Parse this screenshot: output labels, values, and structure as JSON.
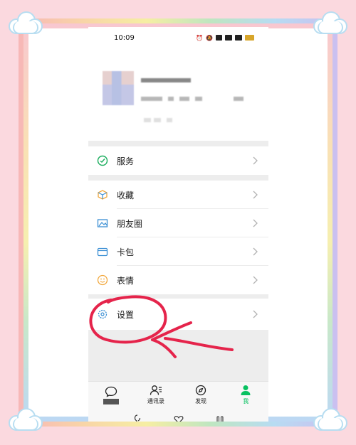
{
  "statusbar": {
    "time": "10:09"
  },
  "menu": {
    "services": "服务",
    "favorites": "收藏",
    "moments": "朋友圈",
    "cards": "卡包",
    "stickers": "表情",
    "settings": "设置"
  },
  "tabs": [
    {
      "label": "",
      "icon": "chat-icon"
    },
    {
      "label": "通讯录",
      "icon": "contacts-icon"
    },
    {
      "label": "发现",
      "icon": "compass-icon"
    },
    {
      "label": "我",
      "icon": "person-icon"
    }
  ],
  "colors": {
    "accent": "#07c160",
    "annotation": "#e5244b",
    "page_bg": "#fbd9df"
  }
}
